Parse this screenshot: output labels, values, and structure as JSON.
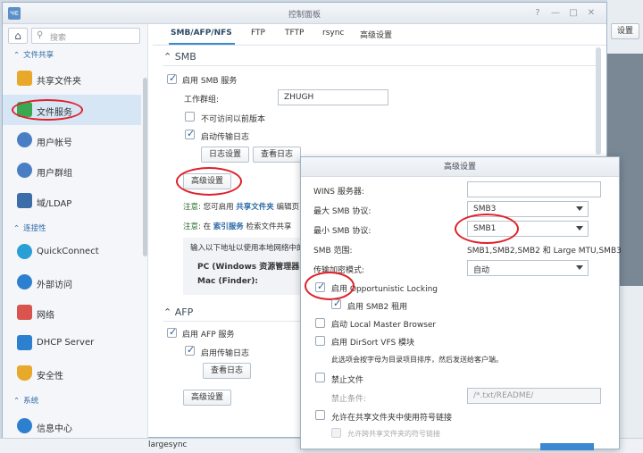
{
  "window": {
    "title": "控制面板",
    "app_icon_text": "ЧЄ"
  },
  "sidebar": {
    "search_placeholder": "搜索",
    "sections": [
      {
        "label": "文件共享"
      },
      {
        "label": "连接性"
      },
      {
        "label": "系统"
      }
    ],
    "items": [
      {
        "label": "共享文件夹",
        "color": "#e8a82a"
      },
      {
        "label": "文件服务",
        "color": "#3aa853"
      },
      {
        "label": "用户帐号",
        "color": "#4a7ec4"
      },
      {
        "label": "用户群组",
        "color": "#4a7ec4"
      },
      {
        "label": "域/LDAP",
        "color": "#3b6ea8"
      },
      {
        "label": "QuickConnect",
        "color": "#2a9fd6"
      },
      {
        "label": "外部访问",
        "color": "#2d7fd0"
      },
      {
        "label": "网络",
        "color": "#d9534f"
      },
      {
        "label": "DHCP Server",
        "color": "#2d7fd0"
      },
      {
        "label": "安全性",
        "color": "#e8a82a"
      },
      {
        "label": "信息中心",
        "color": "#2d7fd0"
      }
    ]
  },
  "tabs": [
    {
      "label": "SMB/AFP/NFS"
    },
    {
      "label": "FTP"
    },
    {
      "label": "TFTP"
    },
    {
      "label": "rsync"
    },
    {
      "label": "高级设置"
    }
  ],
  "smb": {
    "title": "SMB",
    "enable_label": "启用 SMB 服务",
    "workgroup_label": "工作群组:",
    "workgroup_value": "ZHUGH",
    "no_prev_versions_label": "不可访问以前版本",
    "transfer_log_label": "启动传输日志",
    "log_settings_btn": "日志设置",
    "view_log_btn": "查看日志",
    "advanced_btn": "高级设置",
    "note1_prefix": "注意:",
    "note1_text": "您可启用",
    "note1_link": "共享文件夹",
    "note1_suffix": "编辑页",
    "note2_prefix": "注意:",
    "note2_text": "在",
    "note2_link": "索引服务",
    "note2_suffix": "检索文件共享",
    "access_intro": "输入以下地址以使用本地网络中的",
    "pc_label": "PC (Windows 资源管理器):",
    "mac_label": "Mac (Finder):"
  },
  "afp": {
    "title": "AFP",
    "enable_label": "启用 AFP 服务",
    "transfer_log_label": "启用传输日志",
    "view_log_btn": "查看日志",
    "advanced_btn": "高级设置"
  },
  "popup": {
    "title": "高级设置",
    "wins_label": "WINS 服务器:",
    "wins_value": "",
    "max_smb_label": "最大 SMB 协议:",
    "max_smb_value": "SMB3",
    "min_smb_label": "最小 SMB 协议:",
    "min_smb_value": "SMB1",
    "smb_range_label": "SMB 范围:",
    "smb_range_value": "SMB1,SMB2,SMB2 和 Large MTU,SMB3",
    "encrypt_label": "传输加密模式:",
    "encrypt_value": "自动",
    "oplock_label": "启用 Opportunistic Locking",
    "smb2_lease_label": "启用 SMB2 租用",
    "local_master_label": "启动 Local Master Browser",
    "dirsort_label": "启用 DirSort VFS 模块",
    "dirsort_desc": "此选项会按字母为目录项目排序，然后发送给客户端。",
    "veto_label": "禁止文件",
    "veto_cond_label": "禁止条件:",
    "veto_cond_placeholder": "/*.txt/README/",
    "symlink_label": "允许在共享文件夹中使用符号链接",
    "symlink_cross_label": "允许跨共享文件夹的符号链接"
  },
  "background": {
    "right_btn": "设置",
    "taskbar_item": "largesync"
  }
}
